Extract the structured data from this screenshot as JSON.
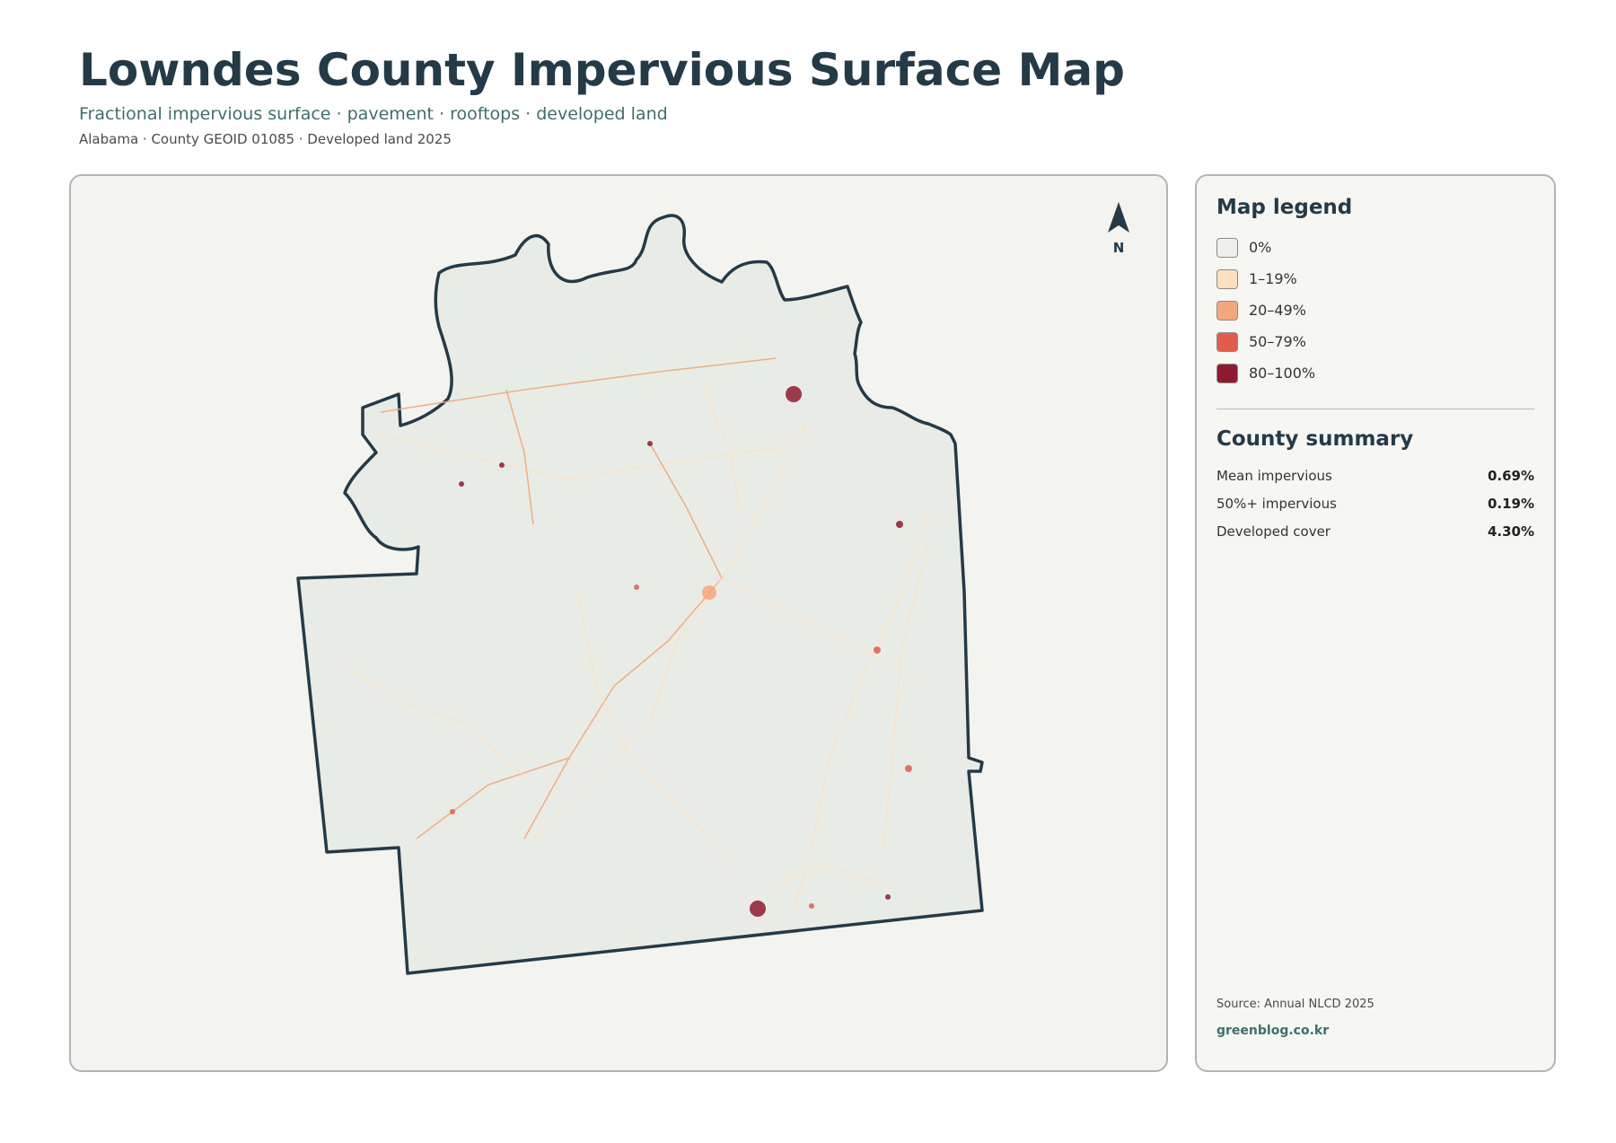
{
  "header": {
    "title": "Lowndes County Impervious Surface Map",
    "subtitle": "Fractional impervious surface · pavement · rooftops · developed land",
    "meta": "Alabama · County GEOID 01085 · Developed land 2025"
  },
  "map": {
    "north_label": "N",
    "boundary_color": "#243a47",
    "land_color": "#e9ece6"
  },
  "legend": {
    "title": "Map legend",
    "items": [
      {
        "label": "0%",
        "color": "#efefec"
      },
      {
        "label": "1–19%",
        "color": "#fde0bf"
      },
      {
        "label": "20–49%",
        "color": "#f4a77c"
      },
      {
        "label": "50–79%",
        "color": "#e05d4e"
      },
      {
        "label": "80–100%",
        "color": "#8f1a30"
      }
    ]
  },
  "summary": {
    "title": "County summary",
    "stats": [
      {
        "label": "Mean impervious",
        "value": "0.69%"
      },
      {
        "label": "50%+ impervious",
        "value": "0.19%"
      },
      {
        "label": "Developed cover",
        "value": "4.30%"
      }
    ]
  },
  "footer": {
    "source": "Source: Annual NLCD 2025",
    "credit": "greenblog.co.kr"
  }
}
